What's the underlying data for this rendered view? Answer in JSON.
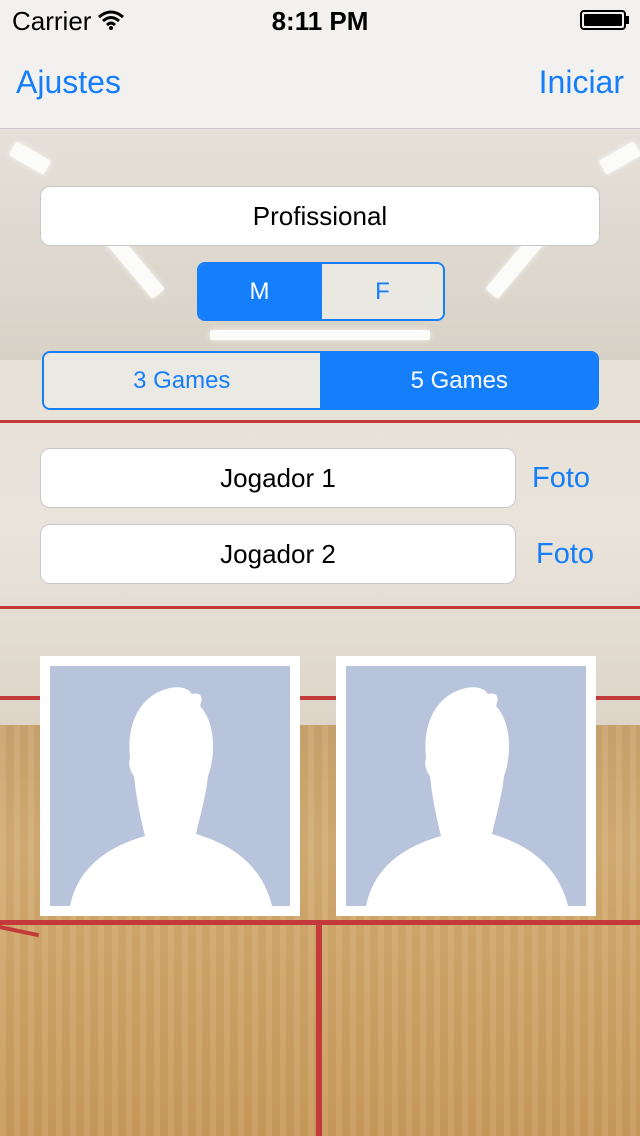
{
  "status_bar": {
    "carrier": "Carrier",
    "time": "8:11 PM",
    "wifi_icon": "wifi-icon",
    "battery_icon": "battery-icon"
  },
  "nav": {
    "left_label": "Ajustes",
    "right_label": "Iniciar"
  },
  "form": {
    "category_value": "Profissional",
    "gender_segment": {
      "options": [
        "M",
        "F"
      ],
      "selected": "M"
    },
    "games_segment": {
      "options": [
        "3 Games",
        "5 Games"
      ],
      "selected": "5 Games"
    },
    "players": [
      {
        "name": "Jogador 1",
        "photo_label": "Foto"
      },
      {
        "name": "Jogador 2",
        "photo_label": "Foto"
      }
    ]
  },
  "avatars": [
    {
      "icon": "person-placeholder-icon"
    },
    {
      "icon": "person-placeholder-icon"
    }
  ],
  "colors": {
    "accent": "#157efb",
    "avatar_bg": "#b8c3dc",
    "court_line": "#c43a3a"
  }
}
